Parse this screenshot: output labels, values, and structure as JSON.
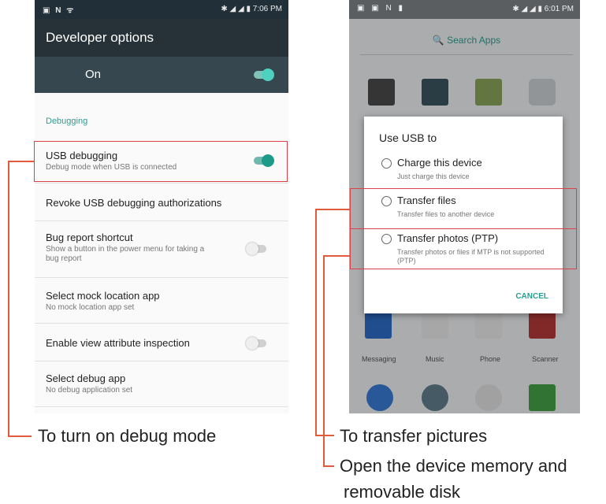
{
  "left": {
    "status_left": "▣ N ᯤ",
    "status_right": "✱ ◢ ◢ ▮ 7:06 PM",
    "appbar_title": "Developer options",
    "master_label": "On",
    "section": "Debugging",
    "rows": [
      {
        "title": "USB debugging",
        "sub": "Debug mode when USB is connected",
        "toggle": "on"
      },
      {
        "title": "Revoke USB debugging authorizations",
        "sub": ""
      },
      {
        "title": "Bug report shortcut",
        "sub": "Show a button in the power menu for taking a bug report",
        "toggle": "off"
      },
      {
        "title": "Select mock location app",
        "sub": "No mock location app set"
      },
      {
        "title": "Enable view attribute inspection",
        "sub": "",
        "toggle": "off"
      },
      {
        "title": "Select debug app",
        "sub": "No debug application set"
      }
    ]
  },
  "right": {
    "status_left": "▣ ▣ N ▮",
    "status_right": "✱ ◢ ◢ ▮ 6:01 PM",
    "search": "🔍 Search Apps",
    "dialog_title": "Use USB to",
    "options": [
      {
        "title": "Charge this device",
        "sub": "Just charge this device"
      },
      {
        "title": "Transfer files",
        "sub": "Transfer files to another device"
      },
      {
        "title": "Transfer photos (PTP)",
        "sub": "Transfer photos or files if MTP is not supported (PTP)"
      }
    ],
    "cancel": "CANCEL",
    "dock_labels": [
      "Messaging",
      "Music",
      "Phone",
      "Scanner"
    ]
  },
  "captions": {
    "debug": "To turn on debug mode",
    "transfer": "To transfer pictures",
    "memory_line1": "Open the device memory and",
    "memory_line2": "removable disk"
  },
  "colors": {
    "accent": "#2a9d8f",
    "highlight": "#d9404a",
    "callout": "#e05a3c"
  }
}
